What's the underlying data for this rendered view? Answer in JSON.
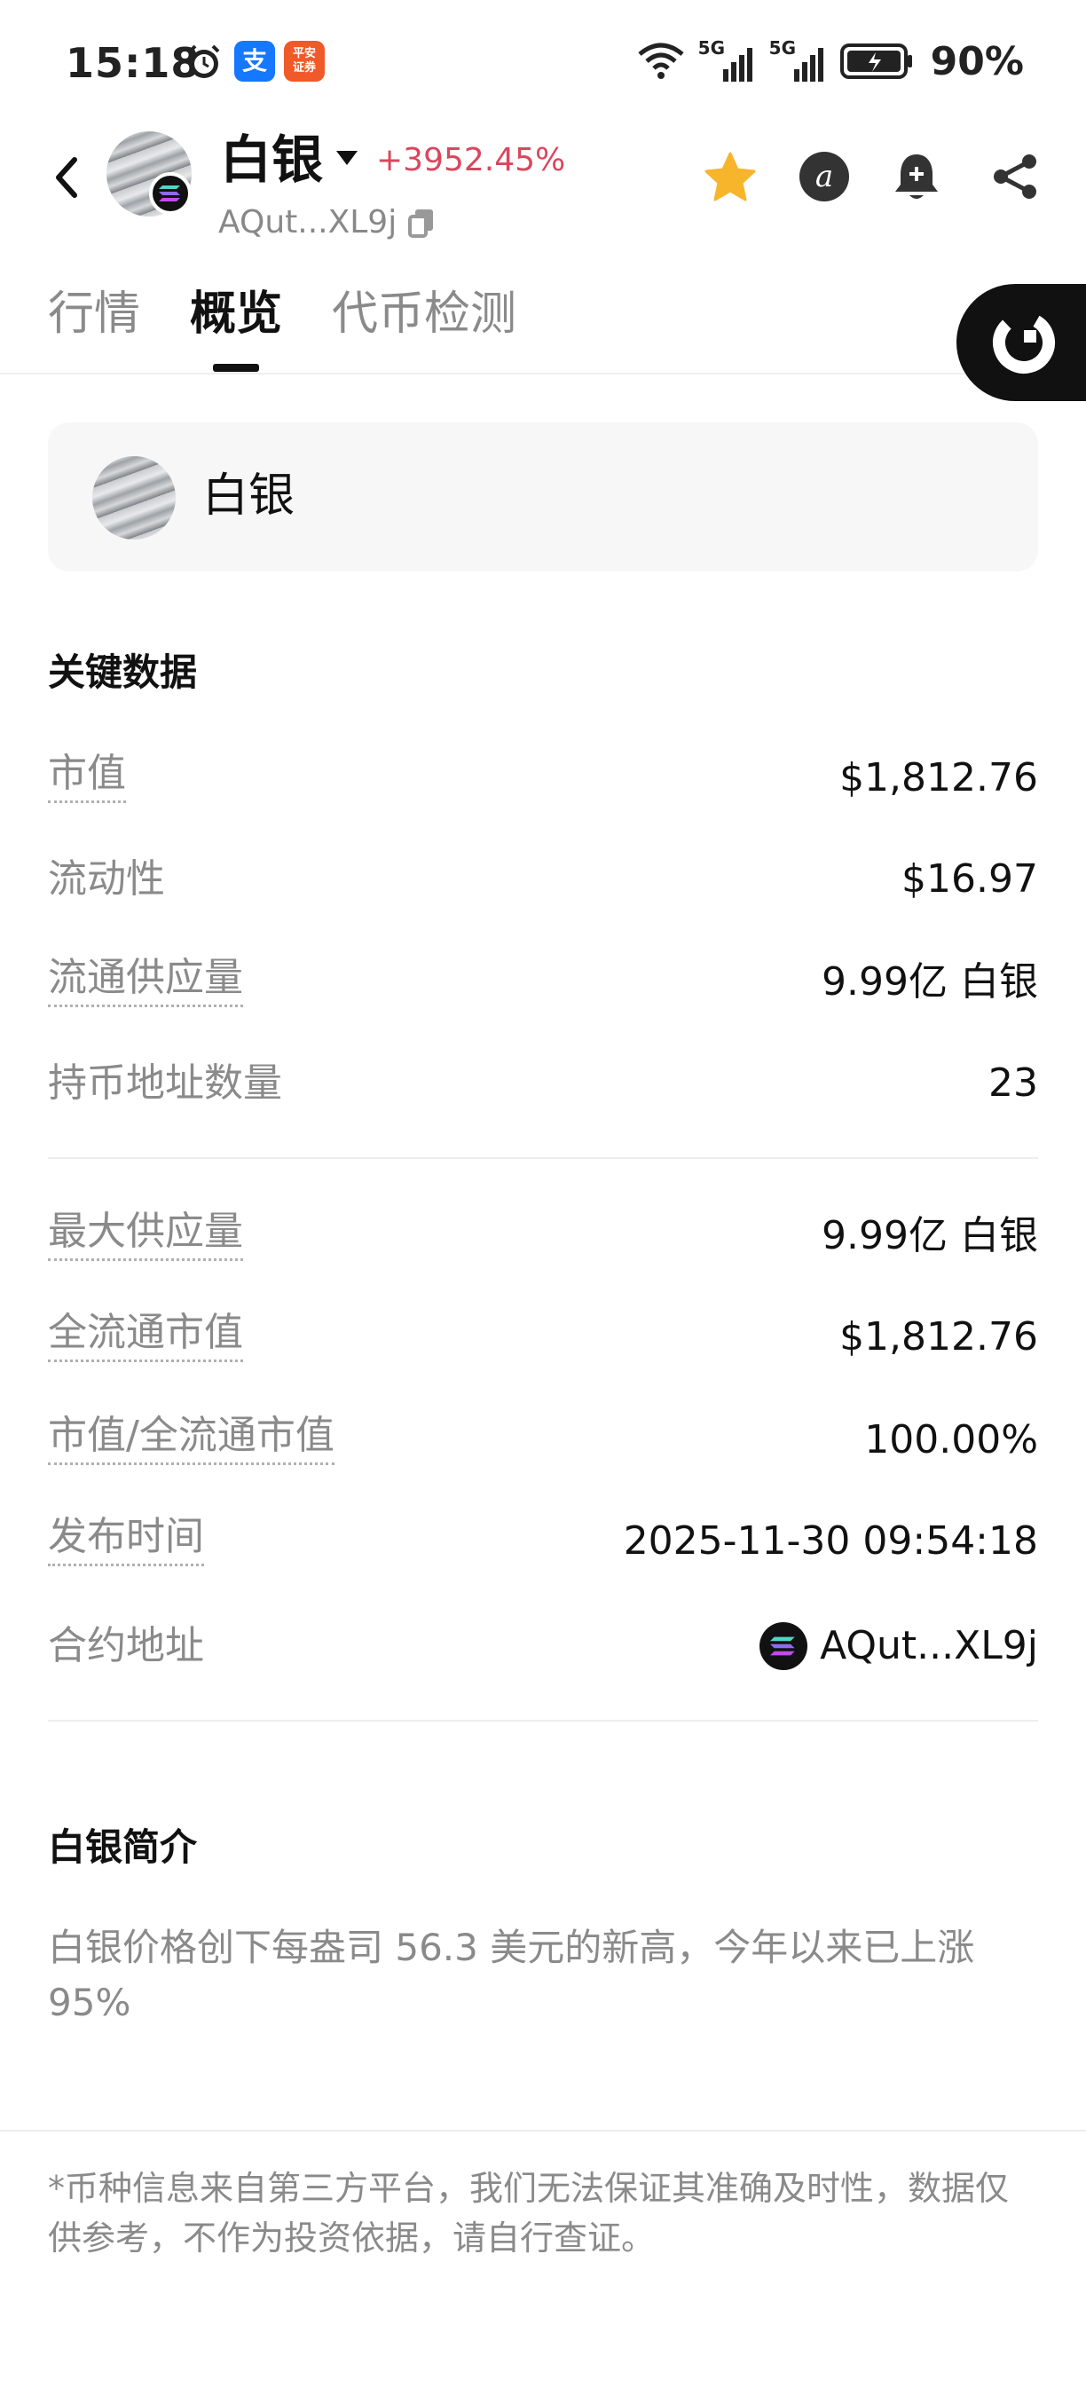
{
  "status_bar": {
    "time": "15:18",
    "battery": "90%",
    "alipay_glyph": "支",
    "pingan_glyph": "平安\n证券",
    "network": [
      "5G",
      "5G"
    ]
  },
  "header": {
    "token_name": "白银",
    "price_change": "+3952.45%",
    "contract_short": "AQut...XL9j"
  },
  "tabs": [
    {
      "label": "行情"
    },
    {
      "label": "概览"
    },
    {
      "label": "代币检测"
    }
  ],
  "card": {
    "name": "白银"
  },
  "key_data": {
    "title": "关键数据",
    "rows": [
      {
        "label": "市值",
        "value": "$1,812.76"
      },
      {
        "label": "流动性",
        "value": "$16.97"
      },
      {
        "label": "流通供应量",
        "value": "9.99亿 白银"
      },
      {
        "label": "持币地址数量",
        "value": "23"
      },
      {
        "label": "最大供应量",
        "value": "9.99亿 白银"
      },
      {
        "label": "全流通市值",
        "value": "$1,812.76"
      },
      {
        "label": "市值/全流通市值",
        "value": "100.00%"
      },
      {
        "label": "发布时间",
        "value": "2025-11-30 09:54:18"
      },
      {
        "label": "合约地址",
        "value": "AQut...XL9j"
      }
    ]
  },
  "intro": {
    "title": "白银简介",
    "text": "白银价格创下每盎司 56.3 美元的新高，今年以来已上涨 95%"
  },
  "disclaimer": "*币种信息来自第三方平台，我们无法保证其准确及时性，数据仅供参考，不作为投资依据，请自行查证。",
  "colors": {
    "price_up": "#d9475d",
    "star": "#f7b52c",
    "muted_text": "#8a8a8a"
  },
  "icons": [
    "back-icon",
    "chevron-down-icon",
    "copy-icon",
    "star-icon",
    "alpha-icon",
    "bell-plus-icon",
    "share-icon",
    "solana-icon",
    "alarm-icon",
    "wifi-icon",
    "signal-icon",
    "battery-icon"
  ]
}
